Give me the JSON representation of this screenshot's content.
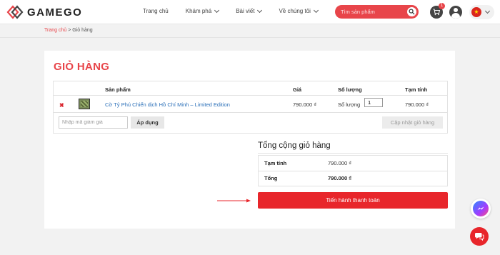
{
  "header": {
    "brand": "GAMEGO",
    "nav": [
      {
        "label": "Trang chủ",
        "has_dropdown": false
      },
      {
        "label": "Khám phá",
        "has_dropdown": true
      },
      {
        "label": "Bài viết",
        "has_dropdown": true
      },
      {
        "label": "Về chúng tôi",
        "has_dropdown": true
      }
    ],
    "search_placeholder": "Tìm sản phẩm",
    "cart_count": "1",
    "accent_color": "#e8454a"
  },
  "breadcrumb": {
    "home": "Trang chủ",
    "separator": " > ",
    "current": "Giỏ hàng"
  },
  "cart": {
    "title": "GIỎ HÀNG",
    "columns": {
      "product": "Sản phẩm",
      "price": "Giá",
      "quantity": "Số lượng",
      "subtotal": "Tạm tính"
    },
    "items": [
      {
        "name": "Cờ Tỷ Phú Chiến dịch Hồ Chí Minh – Limited Edition",
        "price": "790.000 ₫",
        "quantity_label": "Số lượng",
        "quantity": "1",
        "subtotal": "790.000 ₫"
      }
    ],
    "coupon_placeholder": "Nhập mã giảm giá",
    "apply_label": "Áp dụng",
    "update_label": "Cập nhật giỏ hàng"
  },
  "totals": {
    "title": "Tổng cộng giỏ hàng",
    "subtotal_label": "Tạm tính",
    "subtotal_value": "790.000 ₫",
    "total_label": "Tổng",
    "total_value": "790.000 ₫",
    "checkout_label": "Tiến hành thanh toán",
    "checkout_color": "#e8262b"
  }
}
